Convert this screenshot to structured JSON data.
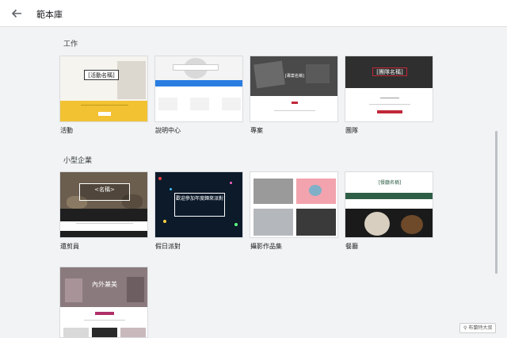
{
  "header": {
    "title": "範本庫"
  },
  "sections": [
    {
      "title": "工作",
      "cards": [
        {
          "label": "活動",
          "preview_title": "[活動名稱]"
        },
        {
          "label": "說明中心"
        },
        {
          "label": "專案",
          "preview_title": "[專案名稱]"
        },
        {
          "label": "團隊",
          "preview_title": "[團隊名稱]"
        }
      ]
    },
    {
      "title": "小型企業",
      "cards": [
        {
          "label": "還剪員",
          "preview_title": "<名稱>"
        },
        {
          "label": "假日派對",
          "preview_title": "歡迎參加年度歸來派對"
        },
        {
          "label": "攝影作品集"
        },
        {
          "label": "餐廳",
          "preview_title": "[餐廳名稱]"
        }
      ]
    },
    {
      "title": "",
      "cards": [
        {
          "label": "",
          "preview_title": "內外兼美"
        }
      ]
    }
  ],
  "watermark": "布蘭特大叔",
  "colors": {
    "event_yellow": "#f2c233",
    "help_blue": "#2a7de1",
    "team_green": "#2e5e46",
    "accent_red": "#c0283a",
    "scroll_thumb": "#bdc1c6"
  }
}
